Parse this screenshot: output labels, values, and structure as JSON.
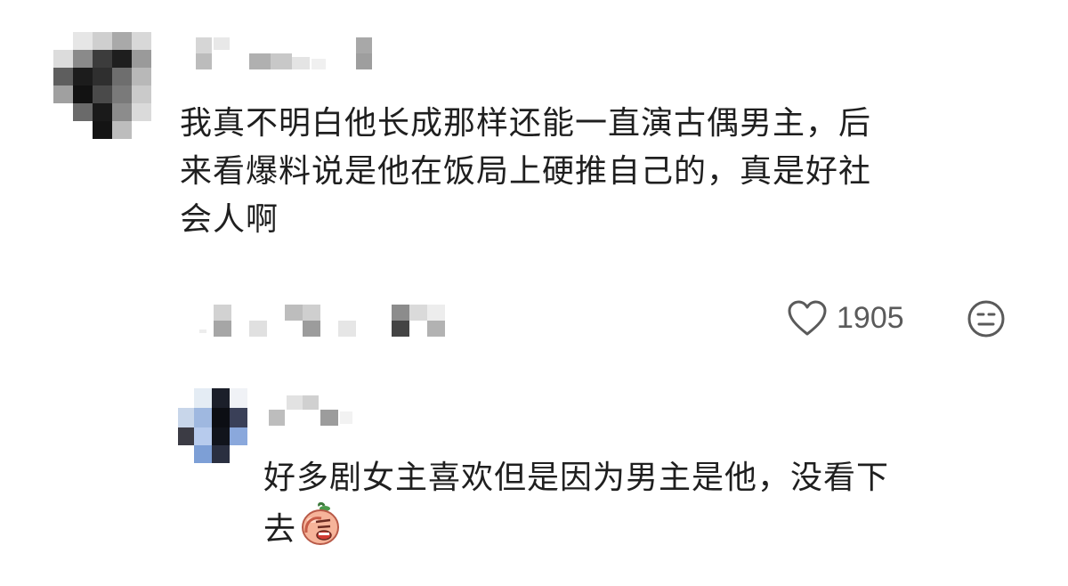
{
  "comment": {
    "text_line1": "我真不明白他长成那样还能一直演古偶男主，后",
    "text_line2": "来看爆料说是他在饭局上硬推自己的，真是好社",
    "text_line3": "会人啊",
    "like_count": "1905",
    "like_icon": "heart-outline-icon",
    "emoji_icon": "smiley-icon"
  },
  "reply": {
    "text_line1": "好多剧女主喜欢但是因为男主是他，没看下",
    "text_line2": "去",
    "sticker_icon": "facepalm-sticker-icon"
  },
  "colors": {
    "text": "#1f1f1f",
    "muted": "#5a5a5a",
    "background": "#ffffff"
  }
}
